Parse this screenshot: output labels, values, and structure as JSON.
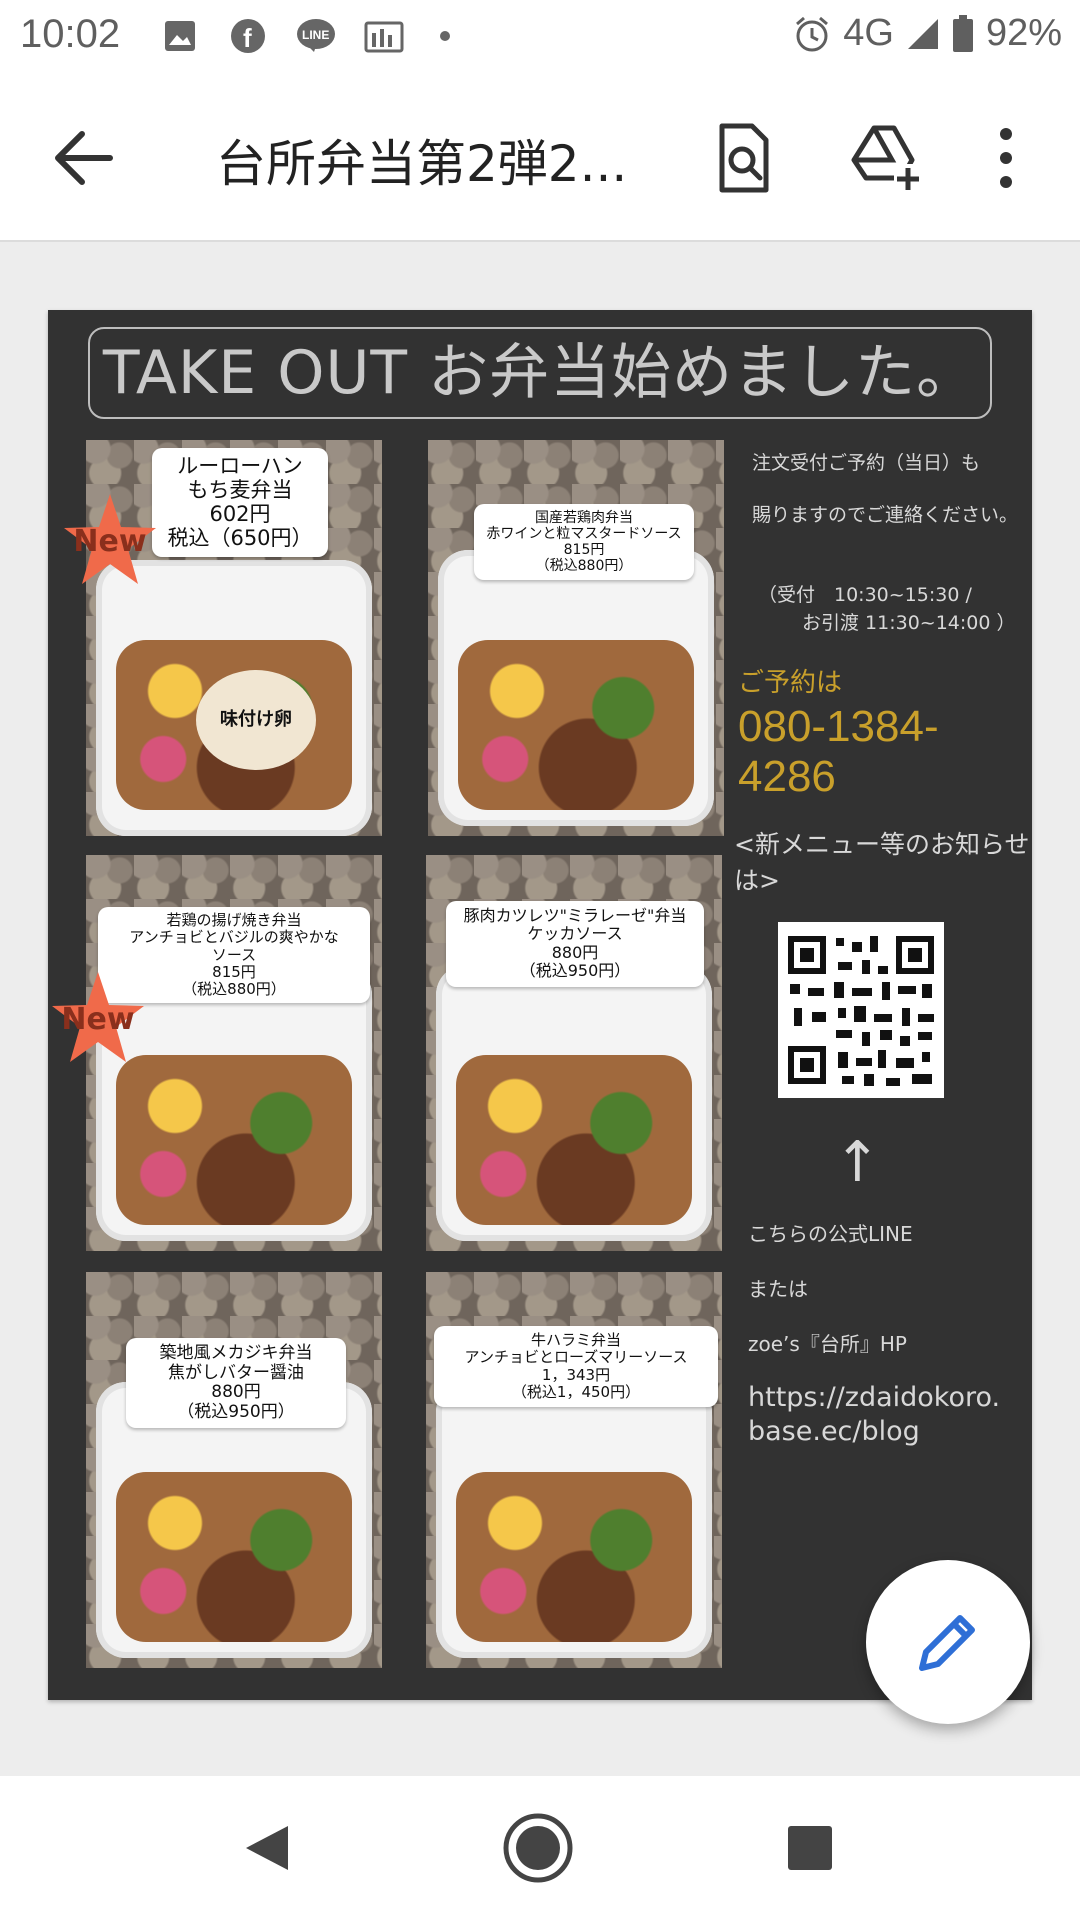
{
  "status_bar": {
    "time": "10:02",
    "battery": "92%",
    "network": "4G",
    "left_icons": [
      "image-icon",
      "facebook-icon",
      "line-icon",
      "gallery-icon",
      "more-dot-icon"
    ],
    "right_icons": [
      "alarm-icon",
      "signal-icon",
      "battery-icon"
    ]
  },
  "toolbar": {
    "title": "台所弁当第2弾2...",
    "icons": [
      "back-arrow-icon",
      "find-in-document-icon",
      "add-to-drive-icon",
      "more-vert-icon"
    ]
  },
  "document": {
    "banner": "TAKE OUT お弁当始めました。",
    "menu": [
      {
        "lines": [
          "ルーローハン",
          "もち麦弁当",
          "602円",
          "税込（650円）"
        ],
        "badge": "New",
        "egg_label": "味付け卵"
      },
      {
        "lines": [
          "国産若鶏肉弁当",
          "赤ワインと粒マスタードソース",
          "815円",
          "（税込880円）"
        ]
      },
      {
        "lines": [
          "若鶏の揚げ焼き弁当",
          "アンチョビとバジルの爽やかな",
          "ソース",
          "815円",
          "（税込880円）"
        ],
        "badge": "New"
      },
      {
        "lines": [
          "豚肉カツレツ\"ミラレーゼ\"弁当",
          "ケッカソース",
          "880円",
          "（税込950円）"
        ]
      },
      {
        "lines": [
          "築地風メカジキ弁当",
          "焦がしバター醤油",
          "880円",
          "（税込950円）"
        ]
      },
      {
        "lines": [
          "牛ハラミ弁当",
          "アンチョビとローズマリーソース",
          "1，343円",
          "（税込1，450円）"
        ]
      }
    ],
    "info": {
      "order_line1": "注文受付ご予約（当日）も",
      "order_line2": "賜りますのでご連絡ください。",
      "hours_line1": "（受付　10:30~15:30 /",
      "hours_line2": "お引渡 11:30~14:00 ）",
      "reserve_label": "ご予約は",
      "phone": "080-1384-4286",
      "news_label": "<新メニュー等のお知らせは>",
      "line_text": "こちらの公式LINE",
      "or_text": "または",
      "hp_text": "zoe’s『台所』HP",
      "url_line1": "https://zdaidokoro.",
      "url_line2": "base.ec/blog"
    }
  },
  "fab": {
    "icon": "edit-pencil-icon"
  },
  "nav_bar": {
    "icons": [
      "back-triangle-icon",
      "home-circle-icon",
      "recents-square-icon"
    ]
  },
  "colors": {
    "page_bg": "#323232",
    "gold": "#c9a02b",
    "fab_icon": "#2f6fd6",
    "badge": "#f06a4a"
  }
}
